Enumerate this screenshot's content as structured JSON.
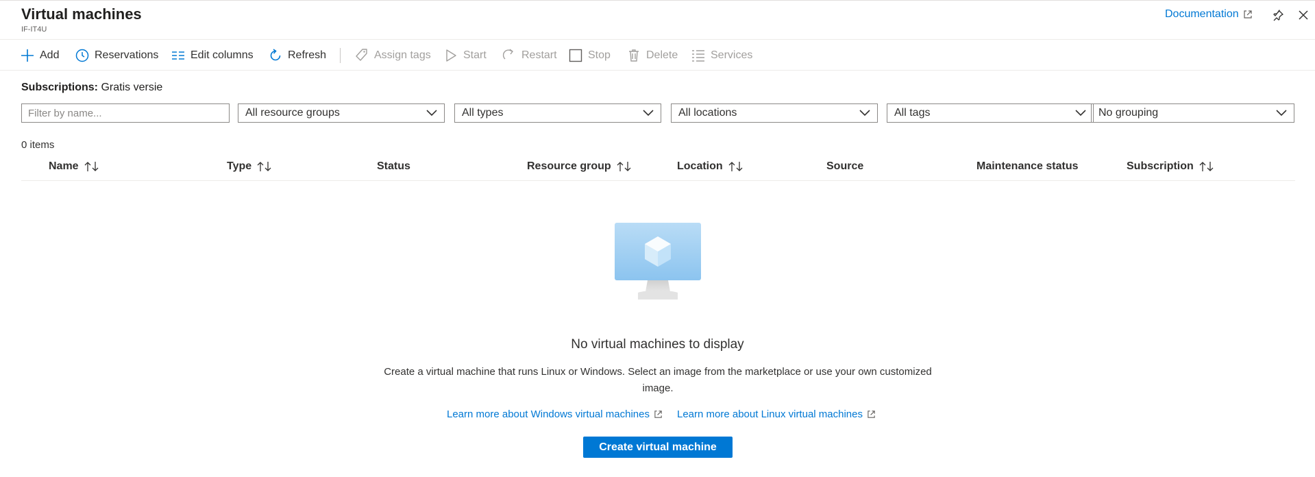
{
  "header": {
    "title": "Virtual machines",
    "subtitle": "IF-IT4U",
    "documentation_label": "Documentation"
  },
  "toolbar": {
    "add": "Add",
    "reservations": "Reservations",
    "edit_columns": "Edit columns",
    "refresh": "Refresh",
    "assign_tags": "Assign tags",
    "start": "Start",
    "restart": "Restart",
    "stop": "Stop",
    "delete": "Delete",
    "services": "Services"
  },
  "subscriptions": {
    "label": "Subscriptions:",
    "value": "Gratis versie"
  },
  "filters": {
    "name_placeholder": "Filter by name...",
    "resource_groups": "All resource groups",
    "types": "All types",
    "locations": "All locations",
    "tags": "All tags",
    "grouping": "No grouping"
  },
  "item_count": "0 items",
  "columns": {
    "name": "Name",
    "type": "Type",
    "status": "Status",
    "resource_group": "Resource group",
    "location": "Location",
    "source": "Source",
    "maintenance_status": "Maintenance status",
    "subscription": "Subscription"
  },
  "empty_state": {
    "title": "No virtual machines to display",
    "description": "Create a virtual machine that runs Linux or Windows. Select an image from the marketplace or use your own customized image.",
    "learn_windows": "Learn more about Windows virtual machines",
    "learn_linux": "Learn more about Linux virtual machines",
    "create_button": "Create virtual machine"
  },
  "colors": {
    "accent": "#0078d4",
    "text": "#323130",
    "disabled": "#a19f9d",
    "border": "#8a8886"
  }
}
